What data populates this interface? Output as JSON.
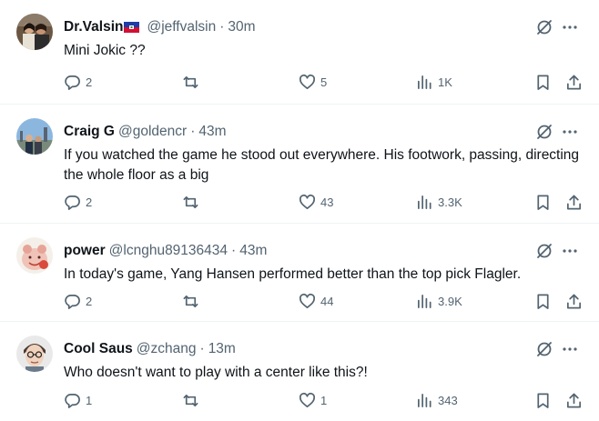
{
  "tweets": [
    {
      "name": "Dr.Valsin",
      "has_flag": true,
      "handle": "@jeffvalsin",
      "sep": "·",
      "time": "30m",
      "text": "Mini Jokic ??",
      "replies": "2",
      "reposts": "",
      "likes": "5",
      "views": "1K"
    },
    {
      "name": "Craig G",
      "has_flag": false,
      "handle": "@goldencr",
      "sep": "·",
      "time": "43m",
      "text": "If you watched the game he stood out everywhere. His footwork, passing, directing the whole floor as a big",
      "replies": "2",
      "reposts": "",
      "likes": "43",
      "views": "3.3K"
    },
    {
      "name": "power",
      "has_flag": false,
      "handle": "@lcnghu89136434",
      "sep": "·",
      "time": "43m",
      "text": "In today's game, Yang Hansen performed better than the top pick Flagler.",
      "replies": "2",
      "reposts": "",
      "likes": "44",
      "views": "3.9K"
    },
    {
      "name": "Cool Saus",
      "has_flag": false,
      "handle": "@zchang",
      "sep": "·",
      "time": "13m",
      "text": "Who doesn't want to play with a center like this?!",
      "replies": "1",
      "reposts": "",
      "likes": "1",
      "views": "343"
    }
  ],
  "icons": {
    "reply": "speech-bubble-icon",
    "repost": "repost-arrows-icon",
    "like": "heart-icon",
    "views": "bar-chart-icon",
    "bookmark": "bookmark-icon",
    "share": "share-upload-icon",
    "grok": "grok-slash-icon",
    "more": "more-dots-icon"
  },
  "colors": {
    "text": "#0f1419",
    "secondary": "#536471",
    "divider": "#eff3f4",
    "background": "#ffffff"
  }
}
